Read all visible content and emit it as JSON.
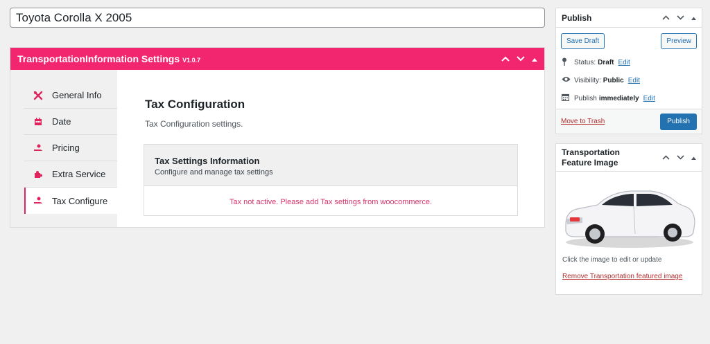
{
  "post": {
    "title": "Toyota Corolla X 2005"
  },
  "metabox": {
    "title": "TransportationInformation Settings",
    "version": "V1.0.7",
    "tabs": [
      {
        "label": "General Info",
        "icon": "tools-icon"
      },
      {
        "label": "Date",
        "icon": "calendar-icon"
      },
      {
        "label": "Pricing",
        "icon": "hand-coins-icon"
      },
      {
        "label": "Extra Service",
        "icon": "puzzle-icon"
      },
      {
        "label": "Tax Configure",
        "icon": "hand-coins-icon",
        "active": true
      }
    ],
    "panel": {
      "title": "Tax Configuration",
      "subtitle": "Tax Configuration settings.",
      "box_title": "Tax Settings Information",
      "box_desc": "Configure and manage tax settings",
      "message": "Tax not active. Please add Tax settings from woocommerce."
    }
  },
  "publish": {
    "title": "Publish",
    "save_draft": "Save Draft",
    "preview": "Preview",
    "status_label": "Status:",
    "status_value": "Draft",
    "visibility_label": "Visibility:",
    "visibility_value": "Public",
    "publish_label": "Publish",
    "publish_value": "immediately",
    "edit": "Edit",
    "trash": "Move to Trash",
    "publish_button": "Publish"
  },
  "featured": {
    "title": "Transportation Feature Image",
    "hint": "Click the image to edit or update",
    "remove": "Remove Transportation featured image"
  },
  "colors": {
    "accent": "#f1266f",
    "primary": "#2271b1",
    "danger": "#b32d2e"
  }
}
